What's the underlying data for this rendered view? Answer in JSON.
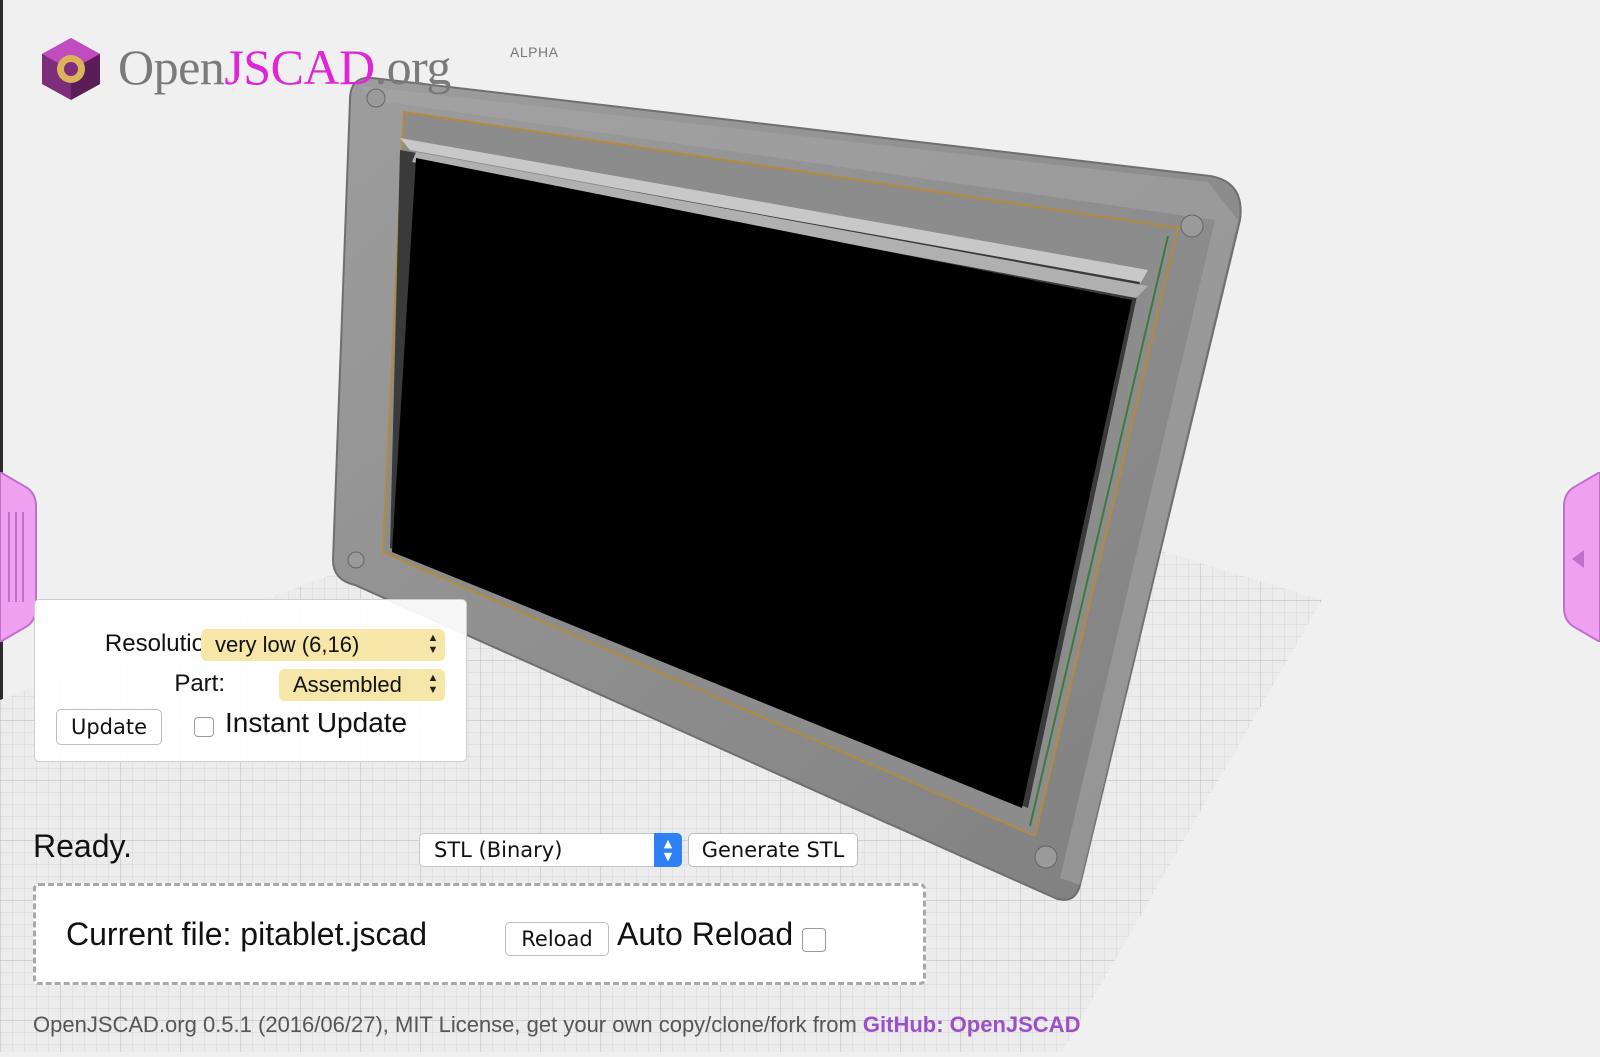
{
  "logo": {
    "text_open": "Open",
    "text_jscad": "JSCAD",
    "text_org": ".org",
    "badge": "ALPHA"
  },
  "parameters": {
    "resolution_label": "Resolution:",
    "resolution_value": "very low (6,16)",
    "part_label": "Part:",
    "part_value": "Assembled",
    "update_button": "Update",
    "instant_update_label": "Instant Update",
    "instant_update_checked": false
  },
  "status": {
    "text": "Ready."
  },
  "export": {
    "format_value": "STL (Binary)",
    "generate_button": "Generate STL"
  },
  "file": {
    "current_file_label": "Current file: pitablet.jscad",
    "reload_button": "Reload",
    "auto_reload_label": "Auto Reload",
    "auto_reload_checked": false
  },
  "footer": {
    "text": "OpenJSCAD.org 0.5.1 (2016/06/27), MIT License, get your own copy/clone/fork from ",
    "link_text": "GitHub: OpenJSCAD"
  },
  "colors": {
    "accent_magenta": "#e024d8",
    "link_purple": "#9b4fc9",
    "select_yellow": "#f6e6a8",
    "stepper_blue": "#2f7ff5",
    "handle_pink": "#f0a0f0"
  }
}
